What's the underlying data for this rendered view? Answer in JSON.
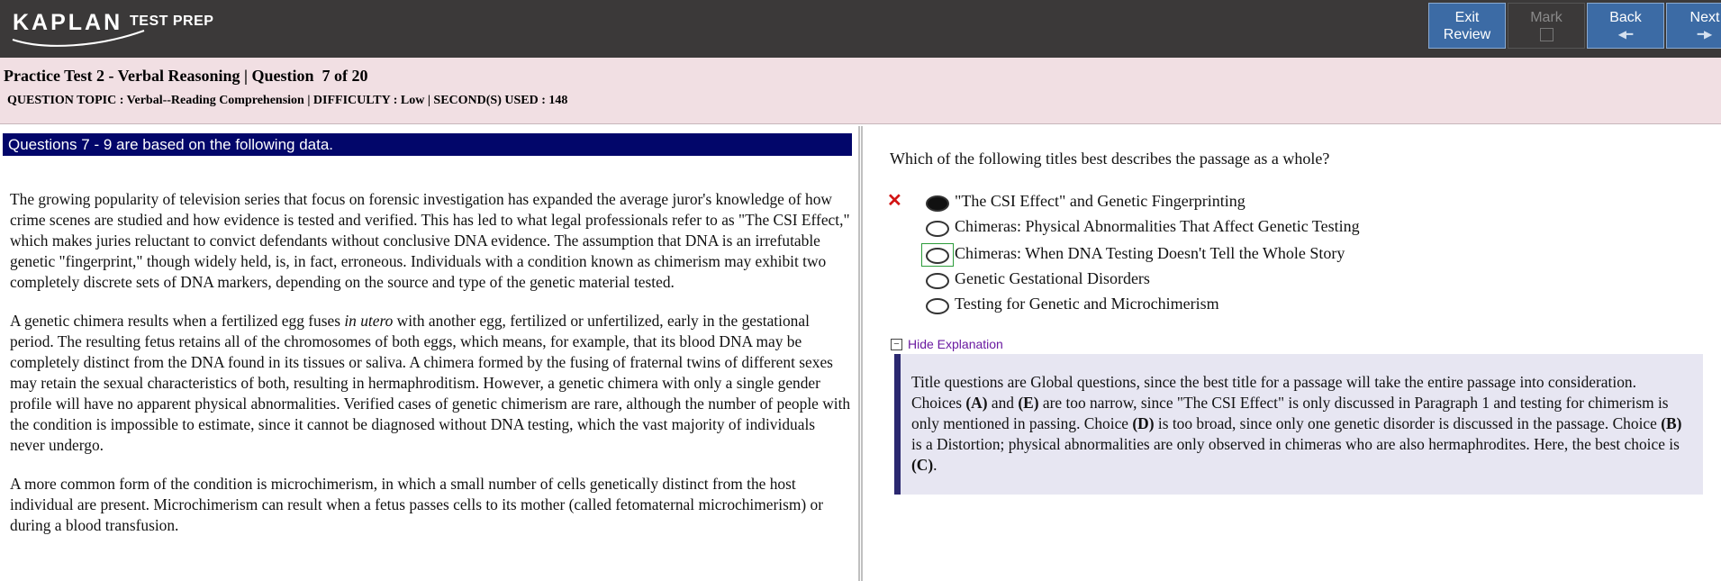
{
  "app": {
    "logo_text": "KAPLAN",
    "logo_suffix": "TEST PREP"
  },
  "nav": {
    "exit_label_1": "Exit",
    "exit_label_2": "Review",
    "mark_label": "Mark",
    "back_label": "Back",
    "next_label": "Next"
  },
  "header": {
    "title": "Practice Test 2 - Verbal Reasoning | Question  7 of 20",
    "meta": "QUESTION TOPIC : Verbal--Reading Comprehension | DIFFICULTY : Low | SECOND(S) USED : 148"
  },
  "passage": {
    "banner": "Questions 7 - 9 are based on the following data.",
    "p1": "The growing popularity of television series that focus on forensic investigation has expanded the average juror's knowledge of how crime scenes are studied and how evidence is tested and verified. This has led to what legal professionals refer to as \"The CSI Effect,\" which makes juries reluctant to convict defendants without conclusive DNA evidence. The assumption that DNA is an irrefutable genetic \"fingerprint,\" though widely held, is, in fact, erroneous. Individuals with a condition known as chimerism may exhibit two completely discrete sets of DNA markers, depending on the source and type of the genetic material tested.",
    "p2_a": "A genetic chimera results when a fertilized egg fuses ",
    "p2_italic": "in utero",
    "p2_b": " with another egg, fertilized or unfertilized, early in the gestational period. The resulting fetus retains all of the chromosomes of both eggs, which means, for example, that its blood DNA may be completely distinct from the DNA found in its tissues or saliva. A chimera formed by the fusing of fraternal twins of different sexes may retain the sexual characteristics of both, resulting in hermaphroditism. However, a genetic chimera with only a single gender profile will have no apparent physical abnormalities. Verified cases of genetic chimerism are rare, although the number of people with the condition is impossible to estimate, since it cannot be diagnosed without DNA testing, which the vast majority of individuals never undergo.",
    "p3": "A more common form of the condition is microchimerism, in which a small number of cells genetically distinct from the host individual are present. Microchimerism can result when a fetus passes cells to its mother (called fetomaternal microchimerism) or during a blood transfusion."
  },
  "question": {
    "stem": "Which of the following titles best describes the passage as a whole?",
    "wrong_mark": "✕",
    "choices": [
      "\"The CSI Effect\" and Genetic Fingerprinting",
      "Chimeras: Physical Abnormalities That Affect Genetic Testing",
      "Chimeras: When DNA Testing Doesn't Tell the Whole Story",
      "Genetic Gestational Disorders",
      "Testing for Genetic and Microchimerism"
    ],
    "selected_index": 0,
    "correct_index": 2
  },
  "explanation": {
    "toggle_label": "Hide Explanation",
    "toggle_symbol": "−",
    "t1": "Title questions are Global questions, since the best title for a passage will take the entire passage into consideration. Choices ",
    "b1": "(A)",
    "t2": " and ",
    "b2": "(E)",
    "t3": " are too narrow, since \"The CSI Effect\" is only discussed in Paragraph 1 and testing for chimerism is only mentioned in passing. Choice ",
    "b3": "(D)",
    "t4": " is too broad, since only one genetic disorder is discussed in the passage. Choice ",
    "b4": "(B)",
    "t5": " is a Distortion; physical abnormalities are only observed in chimeras who are also hermaphrodites. Here, the best choice is ",
    "b5": "(C)",
    "t6": "."
  },
  "colors": {
    "topbar": "#3b3939",
    "button": "#3c6ba5",
    "header_band": "#f1dfe3",
    "banner": "#02066a",
    "explain_bg": "#e7e6f2",
    "wrong": "#d21414",
    "correct_frame": "#2c9c3a"
  }
}
